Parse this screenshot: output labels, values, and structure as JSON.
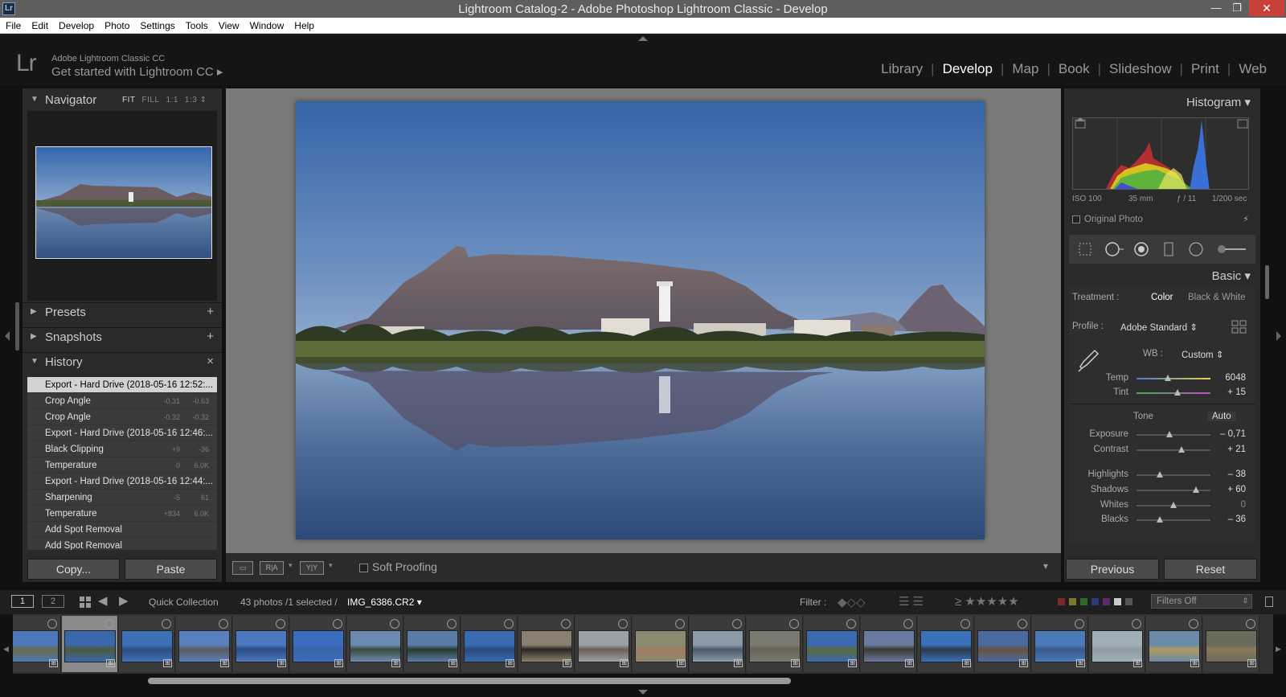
{
  "window": {
    "title": "Lightroom Catalog-2 - Adobe Photoshop Lightroom Classic - Develop",
    "app_icon": "Lr",
    "min": "—",
    "max": "❐",
    "close": "✕"
  },
  "menu": [
    "File",
    "Edit",
    "Develop",
    "Photo",
    "Settings",
    "Tools",
    "View",
    "Window",
    "Help"
  ],
  "identity": {
    "logo": "Lr",
    "line1": "Adobe Lightroom Classic CC",
    "line2": "Get started with Lightroom CC ▸"
  },
  "modules": [
    "Library",
    "Develop",
    "Map",
    "Book",
    "Slideshow",
    "Print",
    "Web"
  ],
  "active_module": "Develop",
  "left": {
    "navigator": {
      "title": "Navigator",
      "opts": [
        "FIT",
        "FILL",
        "1:1",
        "1:3 ⇕"
      ]
    },
    "presets": {
      "title": "Presets",
      "action": "+"
    },
    "snapshots": {
      "title": "Snapshots",
      "action": "+"
    },
    "history": {
      "title": "History",
      "action": "×",
      "items": [
        {
          "label": "Export - Hard Drive (2018-05-16 12:52:...",
          "v1": "",
          "v2": "",
          "selected": true
        },
        {
          "label": "Crop Angle",
          "v1": "-0.31",
          "v2": "-0.63"
        },
        {
          "label": "Crop Angle",
          "v1": "-0.32",
          "v2": "-0.32"
        },
        {
          "label": "Export - Hard Drive (2018-05-16 12:46:...",
          "v1": "",
          "v2": ""
        },
        {
          "label": "Black Clipping",
          "v1": "+9",
          "v2": "-36"
        },
        {
          "label": "Temperature",
          "v1": "0",
          "v2": "6.0K"
        },
        {
          "label": "Export - Hard Drive (2018-05-16 12:44:...",
          "v1": "",
          "v2": ""
        },
        {
          "label": "Sharpening",
          "v1": "-5",
          "v2": "61"
        },
        {
          "label": "Temperature",
          "v1": "+834",
          "v2": "6.0K"
        },
        {
          "label": "Add Spot Removal",
          "v1": "",
          "v2": ""
        },
        {
          "label": "Add Spot Removal",
          "v1": "",
          "v2": ""
        }
      ]
    },
    "copy_btn": "Copy...",
    "paste_btn": "Paste"
  },
  "toolbar": {
    "view_icon": "▭",
    "ra": "R|A",
    "yy": "Y|Y",
    "soft_proofing": "Soft Proofing",
    "dropdown": "▾"
  },
  "right": {
    "histogram_title": "Histogram ▾",
    "exif": {
      "iso": "ISO 100",
      "focal": "35 mm",
      "aperture": "ƒ / 11",
      "shutter": "1/200 sec"
    },
    "original_photo": "Original Photo",
    "basic_title": "Basic ▾",
    "treatment_label": "Treatment :",
    "treatment_color": "Color",
    "treatment_bw": "Black & White",
    "profile_label": "Profile :",
    "profile_value": "Adobe Standard ⇕",
    "wb_label": "WB :",
    "wb_value": "Custom ⇕",
    "tone_label": "Tone",
    "auto_label": "Auto",
    "sliders": [
      {
        "label": "Temp",
        "value": "6048",
        "pos": 0.42
      },
      {
        "label": "Tint",
        "value": "+ 15",
        "pos": 0.55
      },
      {
        "label": "Exposure",
        "value": "– 0,71",
        "pos": 0.45
      },
      {
        "label": "Contrast",
        "value": "+ 21",
        "pos": 0.61
      },
      {
        "label": "Highlights",
        "value": "– 38",
        "pos": 0.31
      },
      {
        "label": "Shadows",
        "value": "+ 60",
        "pos": 0.8
      },
      {
        "label": "Whites",
        "value": "0",
        "pos": 0.5
      },
      {
        "label": "Blacks",
        "value": "– 36",
        "pos": 0.32
      }
    ],
    "previous_btn": "Previous",
    "reset_btn": "Reset"
  },
  "filmstrip": {
    "screen1": "1",
    "screen2": "2",
    "source": "Quick Collection",
    "count": "43 photos /1 selected /",
    "filename": "IMG_6386.CR2 ▾",
    "filter_label": "Filter :",
    "filters_off": "Filters Off",
    "stars": "≥ ★★★★★"
  },
  "colors": {
    "sky_top": "#3a6bb0",
    "sky_bottom": "#7d9fc6",
    "water": "#3c5880",
    "green": "#5a6b3a"
  }
}
